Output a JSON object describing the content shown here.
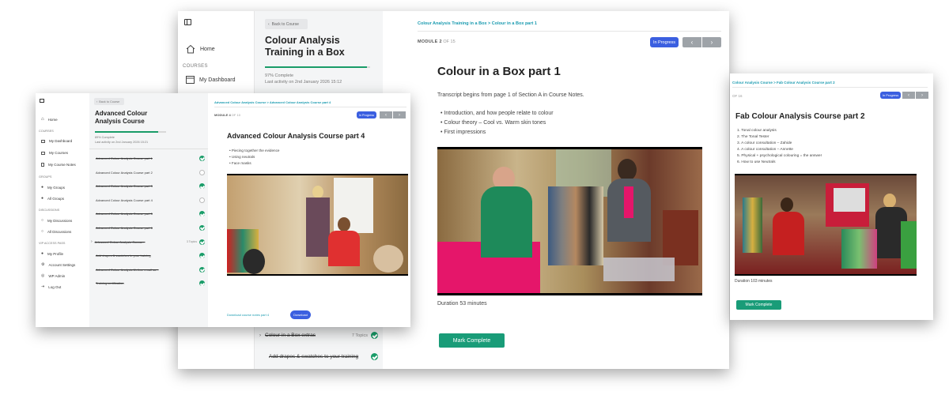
{
  "main": {
    "nav": {
      "home": "Home",
      "courses_heading": "COURSES",
      "dashboard": "My Dashboard"
    },
    "sidebar": {
      "back": "Back to Course",
      "course_title": "Colour Analysis Training in a Box",
      "progress": 0.97,
      "progress_text": "97% Complete",
      "last_activity": "Last activity on 2nd January 2026 15:12",
      "rows": [
        {
          "label": "Colour in a Box extras",
          "topics": "7 Topics"
        },
        {
          "label": "Add drapes & swatches to your training",
          "topics": ""
        }
      ]
    },
    "content": {
      "breadcrumb": "Colour Analysis Training in a Box > Colour in a Box part 1",
      "module_label": "MODULE 2",
      "module_of": "OF 15",
      "status": "In Progress",
      "prev_arrow": "‹",
      "next_arrow": "›",
      "title": "Colour in a Box part 1",
      "intro": "Transcript begins from page 1 of Section A in Course Notes.",
      "bullets": [
        "Introduction, and how people relate to colour",
        "Colour theory – Cool vs. Warm skin tones",
        "First impressions"
      ],
      "duration": "Duration 53 minutes",
      "mark_complete": "Mark Complete"
    }
  },
  "right": {
    "breadcrumb": "Colour Analysis Course > Fab Colour Analysis Course part 2",
    "module_of": "OF 16",
    "status": "In Progress",
    "title": "Fab Colour Analysis Course part 2",
    "items": [
      "1. Tonal colour analysis",
      "2. The Tonal Tester",
      "3. A colour consultation – Zahide",
      "4. A colour consultation – Annette",
      "5. Physical + psychological colouring = the answer",
      "6. How to use Neutrals"
    ],
    "duration": "Duration 103 minutes",
    "mark_complete": "Mark Complete"
  },
  "left": {
    "nav": {
      "home": "Home",
      "courses_heading": "COURSES",
      "dashboard": "My Dashboard",
      "courses": "My Courses",
      "notes": "My Course Notes",
      "groups_heading": "GROUPS",
      "my_groups": "My Groups",
      "all_groups": "All Groups",
      "discussions_heading": "DISCUSSIONS",
      "my_discussions": "My Discussions",
      "all_discussions": "All Discussions",
      "access_heading": "VIP ACCESS PASS",
      "profile": "My Profile",
      "account": "Account Settings",
      "wp_admin": "WP Admin",
      "logout": "Log Out"
    },
    "sidebar": {
      "back": "Back to Course",
      "course_title": "Advanced Colour Analysis Course",
      "progress": 0.89,
      "progress_text": "89% Complete",
      "last_activity": "Last activity on 2nd January 2026 15:21",
      "lessons": [
        {
          "label": "Advanced Colour Analysis Course part 1",
          "done": true,
          "extra": ""
        },
        {
          "label": "Advanced Colour Analysis Course part 2",
          "done": false,
          "extra": ""
        },
        {
          "label": "Advanced Colour Analysis Course part 3",
          "done": true,
          "extra": ""
        },
        {
          "label": "Advanced Colour Analysis Course part 4",
          "done": false,
          "extra": ""
        },
        {
          "label": "Advanced Colour Analysis Course part 5",
          "done": true,
          "extra": ""
        },
        {
          "label": "Advanced Colour Analysis Course part 6",
          "done": true,
          "extra": ""
        },
        {
          "label": "Advanced Colour Analysis Course...",
          "done": true,
          "extra": "3 Topics"
        },
        {
          "label": "Add drapes & swatches to your training",
          "done": true,
          "extra": ""
        },
        {
          "label": "Advanced Colour Analysis lifetime email su...",
          "done": true,
          "extra": ""
        },
        {
          "label": "Training certification",
          "done": true,
          "extra": ""
        }
      ]
    },
    "content": {
      "breadcrumb": "Advanced Colour Analysis Course > Advanced Colour Analysis Course part 4",
      "module_label": "MODULE 4",
      "module_of": "OF 10",
      "status": "In Progress",
      "title": "Advanced Colour Analysis Course part 4",
      "bullets": [
        "Piecing together the evidence",
        "Using neutrals",
        "Face masks"
      ],
      "download_label": "Download course notes part 4",
      "download_button": "Download"
    }
  },
  "colors": {
    "accent_blue": "#3b5fe0",
    "accent_teal": "#1a9bb0",
    "complete_green": "#199c68"
  }
}
